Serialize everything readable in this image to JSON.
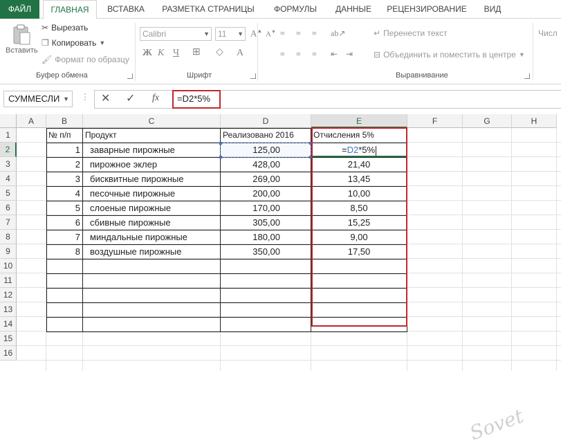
{
  "tabs": [
    "ФАЙЛ",
    "ГЛАВНАЯ",
    "ВСТАВКА",
    "РАЗМЕТКА СТРАНИЦЫ",
    "ФОРМУЛЫ",
    "ДАННЫЕ",
    "РЕЦЕНЗИРОВАНИЕ",
    "ВИД"
  ],
  "ribbon": {
    "paste": "Вставить",
    "cut": "Вырезать",
    "copy": "Копировать",
    "format_painter": "Формат по образцу",
    "clipboard_group": "Буфер обмена",
    "font_name": "Calibri",
    "font_size": "11",
    "font_group": "Шрифт",
    "bold": "Ж",
    "italic": "К",
    "underline": "Ч",
    "wrap_text": "Перенести текст",
    "merge_center": "Объединить и поместить в центре",
    "align_group": "Выравнивание",
    "number_format": "Числ"
  },
  "formula_bar": {
    "name_box": "СУММЕСЛИ",
    "cancel": "✕",
    "enter": "✓",
    "fx": "fx",
    "formula": "=D2*5%"
  },
  "columns": [
    "A",
    "B",
    "C",
    "D",
    "E",
    "F",
    "G",
    "H"
  ],
  "rows": [
    "1",
    "2",
    "3",
    "4",
    "5",
    "6",
    "7",
    "8",
    "9",
    "10",
    "11",
    "12",
    "13",
    "14",
    "15",
    "16"
  ],
  "table": {
    "headers": [
      "№ п/п",
      "Продукт",
      "Реализовано 2016",
      "Отчисления 5%"
    ],
    "rows": [
      {
        "n": "1",
        "product": "заварные пирожные",
        "sold": "125,00",
        "ded_prefix": "=",
        "ded_ref": "D2",
        "ded_suffix": "*5%"
      },
      {
        "n": "2",
        "product": "пирожное эклер",
        "sold": "428,00",
        "ded": "21,40"
      },
      {
        "n": "3",
        "product": "бисквитные пирожные",
        "sold": "269,00",
        "ded": "13,45"
      },
      {
        "n": "4",
        "product": "песочные пирожные",
        "sold": "200,00",
        "ded": "10,00"
      },
      {
        "n": "5",
        "product": "слоеные пирожные",
        "sold": "170,00",
        "ded": "8,50"
      },
      {
        "n": "6",
        "product": "сбивные пирожные",
        "sold": "305,00",
        "ded": "15,25"
      },
      {
        "n": "7",
        "product": "миндальные пирожные",
        "sold": "180,00",
        "ded": "9,00"
      },
      {
        "n": "8",
        "product": "воздушные пирожные",
        "sold": "350,00",
        "ded": "17,50"
      }
    ]
  },
  "watermark": "Sovet"
}
